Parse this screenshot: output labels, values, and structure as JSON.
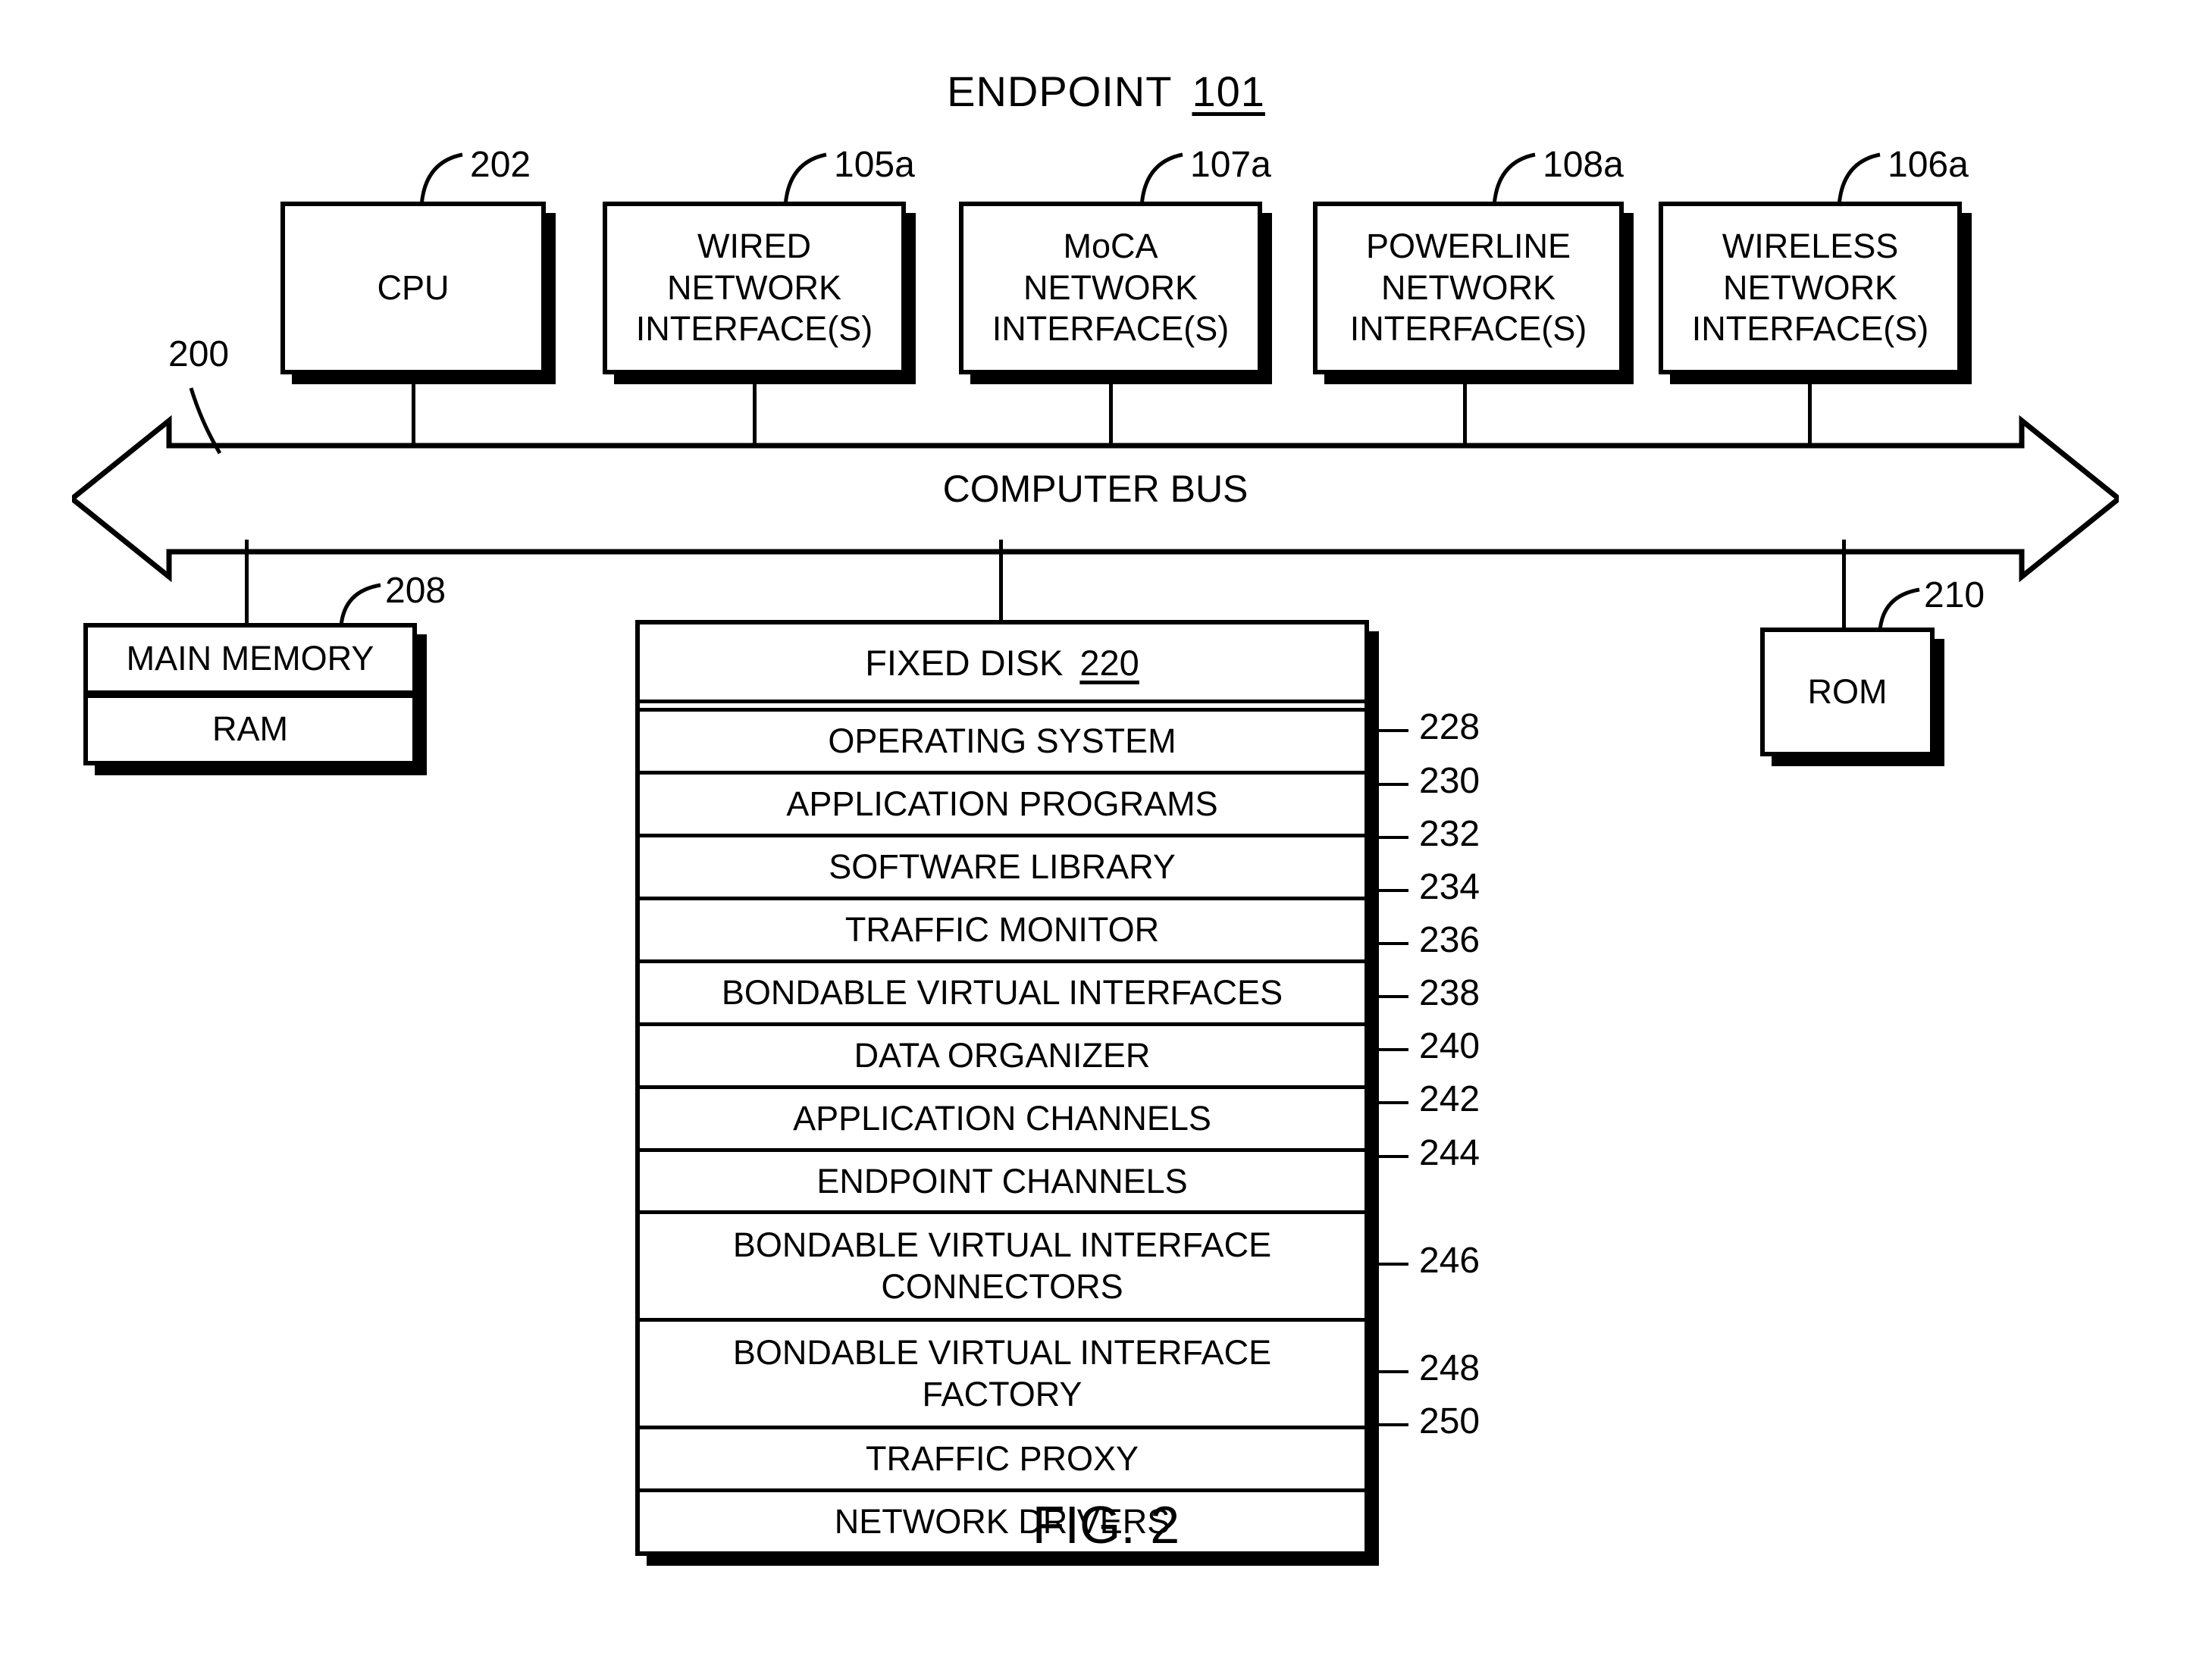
{
  "figure": {
    "title_label": "ENDPOINT",
    "title_ref": "101",
    "caption": "FIG. 2"
  },
  "bus": {
    "label": "COMPUTER BUS",
    "ref": "200"
  },
  "top_components": [
    {
      "label": "CPU",
      "ref": "202"
    },
    {
      "label": "WIRED\nNETWORK\nINTERFACE(S)",
      "line1": "WIRED",
      "line2": "NETWORK",
      "line3": "INTERFACE(S)",
      "ref": "105a"
    },
    {
      "label": "MoCA\nNETWORK\nINTERFACE(S)",
      "line1": "MoCA",
      "line2": "NETWORK",
      "line3": "INTERFACE(S)",
      "ref": "107a"
    },
    {
      "label": "POWERLINE\nNETWORK\nINTERFACE(S)",
      "line1": "POWERLINE",
      "line2": "NETWORK",
      "line3": "INTERFACE(S)",
      "ref": "108a"
    },
    {
      "label": "WIRELESS\nNETWORK\nINTERFACE(S)",
      "line1": "WIRELESS",
      "line2": "NETWORK",
      "line3": "INTERFACE(S)",
      "ref": "106a"
    }
  ],
  "main_memory": {
    "label": "MAIN MEMORY",
    "sub_label": "RAM",
    "ref": "208"
  },
  "rom": {
    "label": "ROM",
    "ref": "210"
  },
  "fixed_disk": {
    "header_label": "FIXED DISK",
    "header_ref": "220",
    "rows": [
      {
        "label": "OPERATING SYSTEM",
        "ref": "228",
        "lines": 1
      },
      {
        "label": "APPLICATION PROGRAMS",
        "ref": "230",
        "lines": 1
      },
      {
        "label": "SOFTWARE LIBRARY",
        "ref": "232",
        "lines": 1
      },
      {
        "label": "TRAFFIC MONITOR",
        "ref": "234",
        "lines": 1
      },
      {
        "label": "BONDABLE VIRTUAL INTERFACES",
        "ref": "236",
        "lines": 1
      },
      {
        "label": "DATA ORGANIZER",
        "ref": "238",
        "lines": 1
      },
      {
        "label": "APPLICATION CHANNELS",
        "ref": "240",
        "lines": 1
      },
      {
        "label": "ENDPOINT CHANNELS",
        "ref": "242",
        "lines": 1
      },
      {
        "label": "BONDABLE VIRTUAL INTERFACE CONNECTORS",
        "ref": "244",
        "lines": 2
      },
      {
        "label": "BONDABLE VIRTUAL INTERFACE FACTORY",
        "ref": "246",
        "lines": 2
      },
      {
        "label": "TRAFFIC PROXY",
        "ref": "248",
        "lines": 1
      },
      {
        "label": "NETWORK DRIVERS",
        "ref": "250",
        "lines": 1
      }
    ]
  },
  "colors": {
    "ink": "#000000",
    "paper": "#ffffff"
  }
}
